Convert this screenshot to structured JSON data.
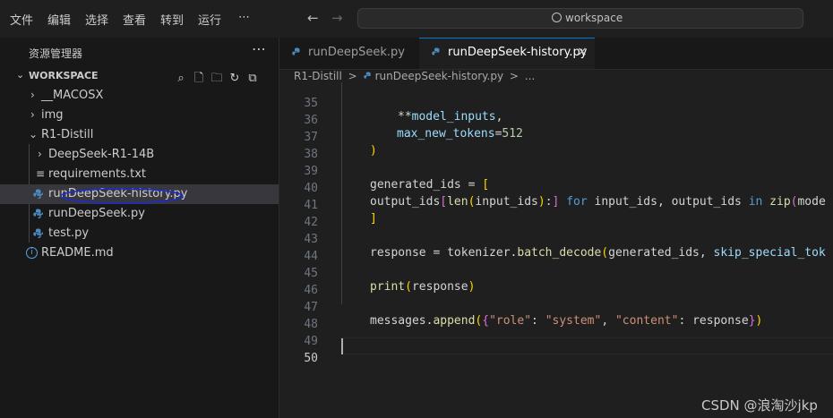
{
  "menu": [
    "文件",
    "编辑",
    "选择",
    "查看",
    "转到",
    "运行",
    "⋯"
  ],
  "nav": {
    "back": "←",
    "forward": "→"
  },
  "search": {
    "text": "workspace"
  },
  "sidebar": {
    "title": "资源管理器",
    "more": "⋯",
    "workspace": "WORKSPACE",
    "tree": [
      {
        "label": "__MACOSX",
        "type": "folder"
      },
      {
        "label": "img",
        "type": "folder"
      },
      {
        "label": "R1-Distill",
        "type": "folder-open"
      },
      {
        "label": "DeepSeek-R1-14B",
        "type": "folder"
      },
      {
        "label": "requirements.txt",
        "type": "txt"
      },
      {
        "label": "runDeepSeek-history.py",
        "type": "py"
      },
      {
        "label": "runDeepSeek.py",
        "type": "py"
      },
      {
        "label": "test.py",
        "type": "py"
      },
      {
        "label": "README.md",
        "type": "md"
      }
    ]
  },
  "tabs": [
    {
      "label": "runDeepSeek.py"
    },
    {
      "label": "runDeepSeek-history.py",
      "close": "×"
    }
  ],
  "breadcrumb": [
    "R1-Distill",
    ">",
    "runDeepSeek-history.py",
    ">",
    "..."
  ],
  "editor": {
    "line_numbers": [
      "35",
      "36",
      "37",
      "38",
      "39",
      "40",
      "41",
      "42",
      "43",
      "44",
      "45",
      "46",
      "47",
      "48",
      "49",
      "50"
    ]
  },
  "watermark": "CSDN @浪淘沙jkp",
  "colors": {
    "accent": "#0078d4",
    "python_icon": "#4b8bbe",
    "selection": "#37373d"
  }
}
